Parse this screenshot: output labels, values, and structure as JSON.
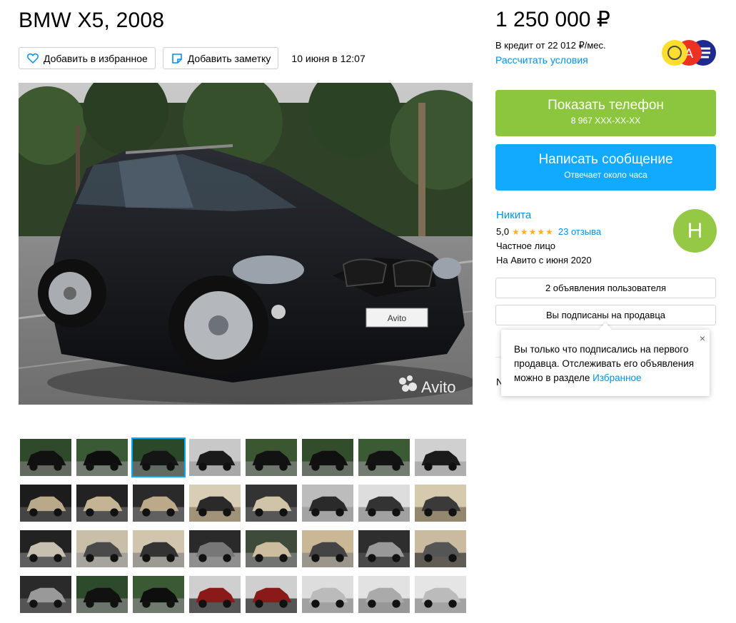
{
  "listing": {
    "title": "BMW X5, 2008",
    "favorite_label": "Добавить в избранное",
    "note_label": "Добавить заметку",
    "date": "10 июня в 12:07",
    "watermark": "Avito",
    "plate": "Avito"
  },
  "price": {
    "amount": "1 250 000 ₽",
    "credit": "В кредит от 22 012 ₽/мес.",
    "calc_link": "Рассчитать условия"
  },
  "contact": {
    "phone_title": "Показать телефон",
    "phone_number": "8 967 XXX-XX-XX",
    "message_title": "Написать сообщение",
    "message_sub": "Отвечает около часа"
  },
  "seller": {
    "name": "Никита",
    "rating": "5,0",
    "stars": "★★★★★",
    "reviews": "23 отзыва",
    "type": "Частное лицо",
    "since": "На Авито с июня 2020",
    "avatar_letter": "Н",
    "ads_button": "2 объявления пользователя",
    "subscribed_button": "Вы подписаны на продавца"
  },
  "popup": {
    "text": "Вы только что подписались на первого продавца. Отслеживать его объявления можно в разделе ",
    "link": "Избранное",
    "close": "×",
    "peek_letter": "N"
  },
  "colors": {
    "green": "#8cc63f",
    "blue": "#11aaff",
    "link": "#0091ea",
    "star": "#ffb021"
  },
  "thumbnails": {
    "count": 32,
    "active_index": 2
  }
}
